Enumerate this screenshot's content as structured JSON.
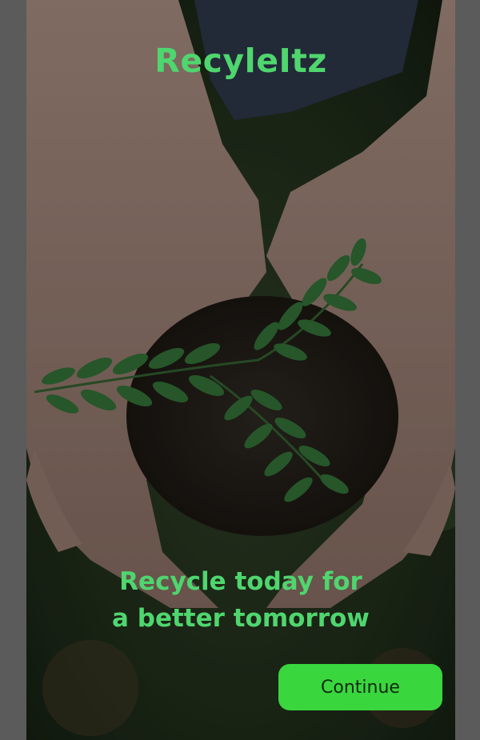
{
  "app": {
    "title": "RecyleItz"
  },
  "hero": {
    "tagline_line1": "Recycle today for",
    "tagline_line2": "a better tomorrow",
    "background_image": "hands-holding-soil-with-seedling"
  },
  "actions": {
    "continue_label": "Continue"
  },
  "colors": {
    "accent": "#4fd66e",
    "button": "#3ad63e",
    "button_text": "#0f2a10"
  }
}
